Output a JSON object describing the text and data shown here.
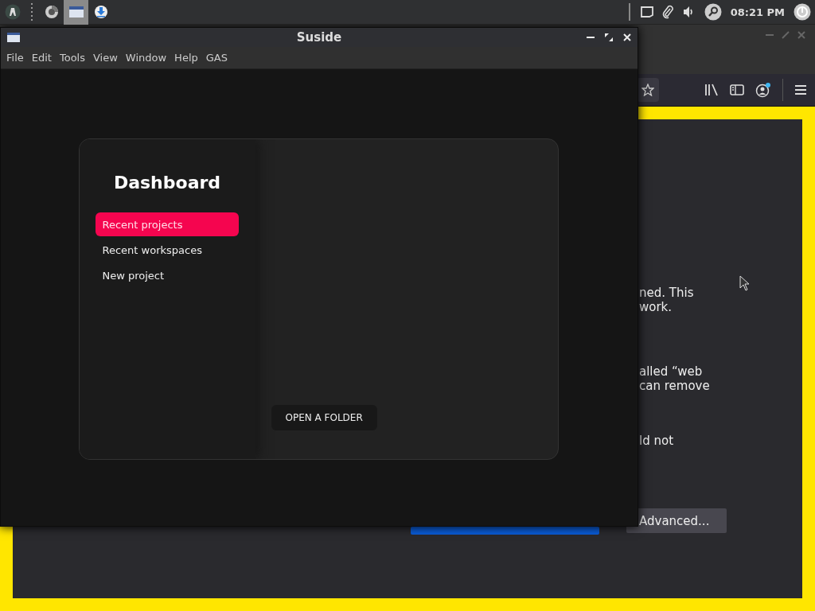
{
  "top_panel": {
    "clock": "08:21 PM",
    "window_button": {
      "selected": true
    }
  },
  "browser_window": {
    "text_fragments": [
      "ned. This",
      "work.",
      "alled “web",
      "can remove",
      "ld not"
    ],
    "buttons": [
      "Advanced..."
    ]
  },
  "suside_window": {
    "title": "Suside",
    "menu": [
      "File",
      "Edit",
      "Tools",
      "View",
      "Window",
      "Help",
      "GAS"
    ],
    "dashboard": {
      "title": "Dashboard",
      "nav": [
        {
          "label": "Recent projects",
          "selected": true
        },
        {
          "label": "Recent workspaces",
          "selected": false
        },
        {
          "label": "New project",
          "selected": false
        }
      ],
      "action_button": "OPEN A FOLDER"
    }
  }
}
